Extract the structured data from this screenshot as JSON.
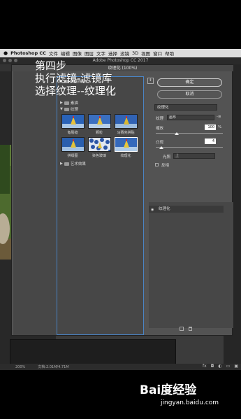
{
  "menubar": {
    "app": "Photoshop CC",
    "items": [
      "文件",
      "编辑",
      "图像",
      "图层",
      "文字",
      "选择",
      "滤镜",
      "3D",
      "视图",
      "窗口",
      "帮助"
    ]
  },
  "window_title": "Adobe Photoshop CC 2017",
  "overlay": {
    "line1": "第四步",
    "line2": "执行滤镜-滤镜库",
    "line3": "选择纹理--纹理化"
  },
  "dialog": {
    "title": "纹理化 (100%)",
    "tree": {
      "item_top": "画笔描边",
      "item_sketch": "素描",
      "item_texture": "纹理",
      "item_art": "艺术效果"
    },
    "thumbs": [
      {
        "label": "龟裂缝"
      },
      {
        "label": "颗粒"
      },
      {
        "label": "马赛克拼贴"
      },
      {
        "label": "拼缀图"
      },
      {
        "label": "染色玻璃"
      },
      {
        "label": "纹理化"
      }
    ],
    "ok_label": "确定",
    "cancel_label": "取消",
    "filter_value": "纹理化",
    "texture_label": "纹理",
    "texture_value": "画布",
    "scale_label": "缩放",
    "scale_value": "100",
    "scale_unit": "%",
    "relief_label": "凸现",
    "relief_value": "4",
    "light_label": "光照",
    "light_value": "上",
    "invert_label": "反相",
    "layer_label": "纹理化"
  },
  "status": {
    "zoom": "200%",
    "doc": "文档:2.01M/4.71M"
  },
  "watermark": {
    "logo": "Bai度经验",
    "url": "jingyan.baidu.com"
  }
}
